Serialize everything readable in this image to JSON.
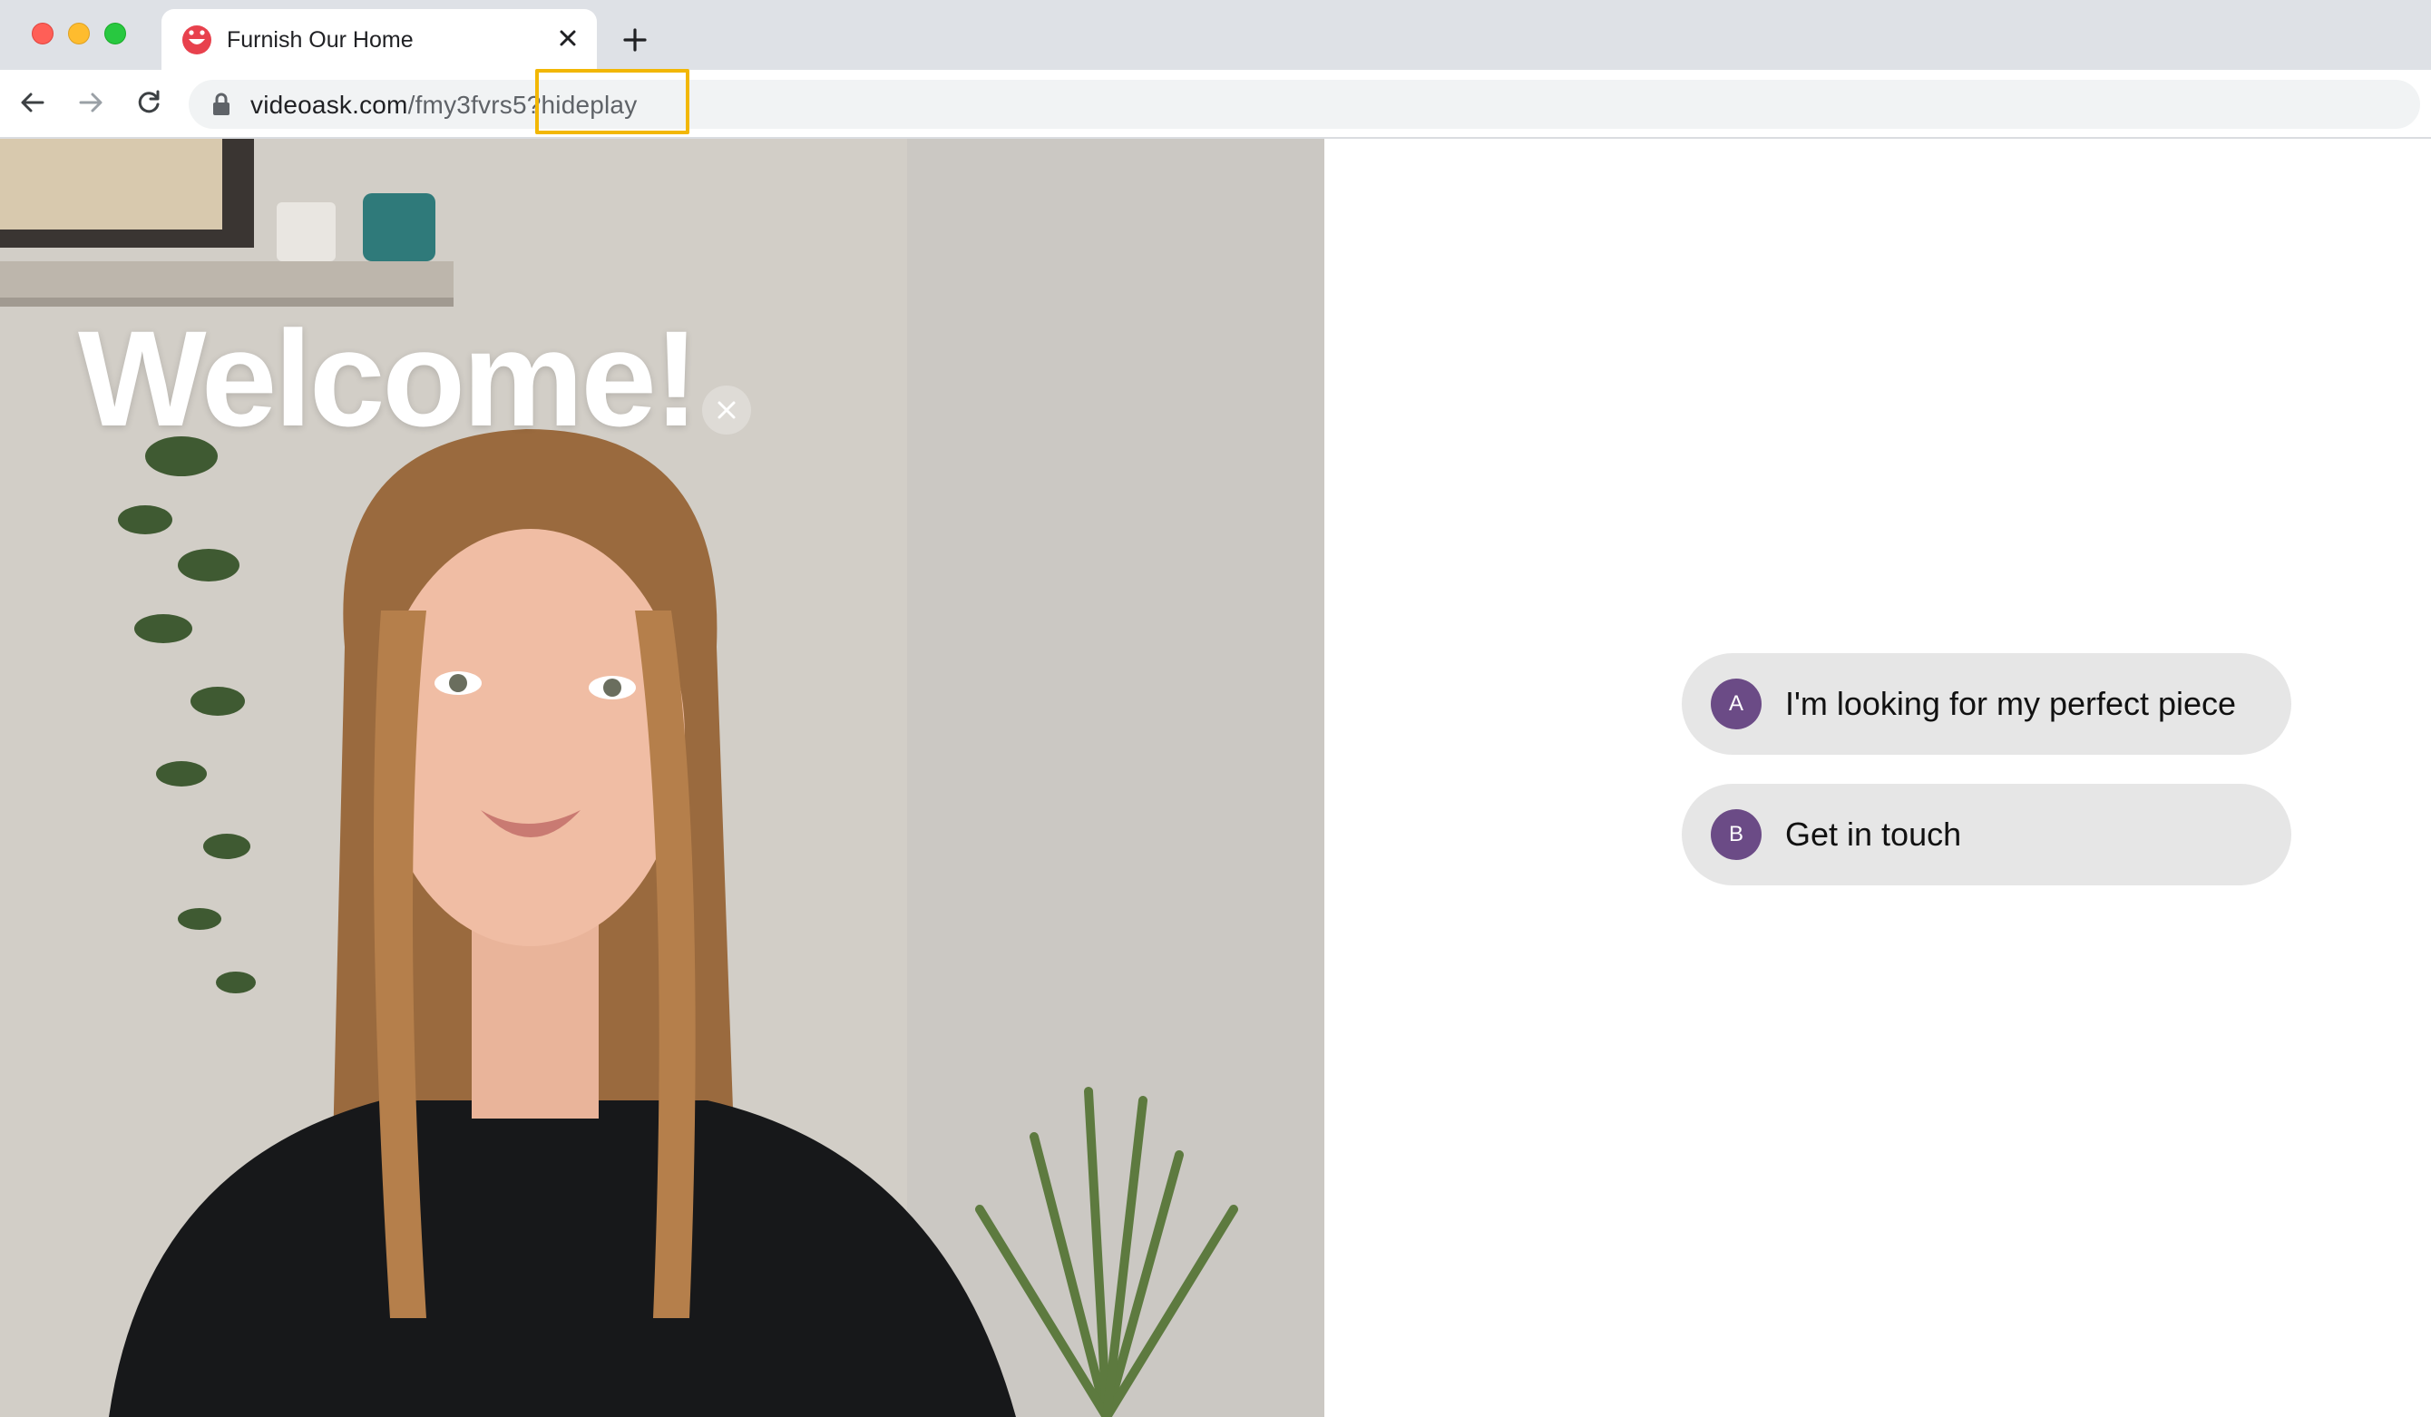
{
  "browser": {
    "tab_title": "Furnish Our Home",
    "url_host": "videoask.com",
    "url_path": "/fmy3fvrs5?hideplay",
    "icons": {
      "traffic_close": "red-dot-icon",
      "traffic_minimize": "yellow-dot-icon",
      "traffic_maximize": "green-dot-icon",
      "favicon": "smiley-favicon-icon",
      "tab_close": "close-icon",
      "new_tab": "plus-icon",
      "back": "arrow-left-icon",
      "forward": "arrow-right-icon",
      "reload": "reload-icon",
      "lock": "lock-icon"
    },
    "highlight_color": "#f2b705"
  },
  "video": {
    "title": "Welcome!",
    "close_icon": "close-icon"
  },
  "choices": [
    {
      "letter": "A",
      "label": "I'm looking for my perfect piece"
    },
    {
      "letter": "B",
      "label": "Get in touch"
    }
  ],
  "colors": {
    "choice_badge": "#6b4b86",
    "choice_background": "#e6e6e6",
    "favicon": "#e8414d"
  }
}
